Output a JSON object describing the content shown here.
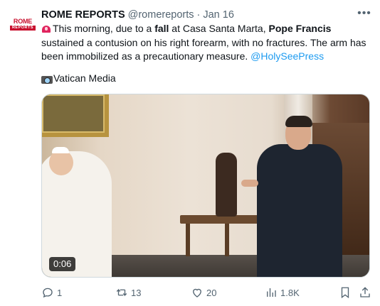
{
  "author": {
    "avatar_text_top": "ROME",
    "avatar_text_bottom": "REPORTS",
    "display_name": "ROME REPORTS",
    "handle": "@romereports",
    "separator": "·",
    "date": "Jan 16"
  },
  "tweet": {
    "text_1": "This morning, due to a ",
    "bold_1": "fall",
    "text_2": " at Casa Santa Marta, ",
    "bold_2": "Pope Francis",
    "text_3": " sustained a contusion on his right forearm, with no fractures. The arm has been immobilized as a precautionary measure. ",
    "mention": "@HolySeePress",
    "credit": "Vatican Media"
  },
  "media": {
    "duration": "0:06"
  },
  "actions": {
    "replies": "1",
    "reposts": "13",
    "likes": "20",
    "views": "1.8K"
  },
  "icons": {
    "more": "more-icon",
    "reply": "reply-icon",
    "repost": "repost-icon",
    "like": "like-icon",
    "views": "views-icon",
    "bookmark": "bookmark-icon",
    "share": "share-icon"
  },
  "colors": {
    "link": "#1d9bf0",
    "secondary_text": "#536471",
    "brand_red": "#c8102e"
  }
}
